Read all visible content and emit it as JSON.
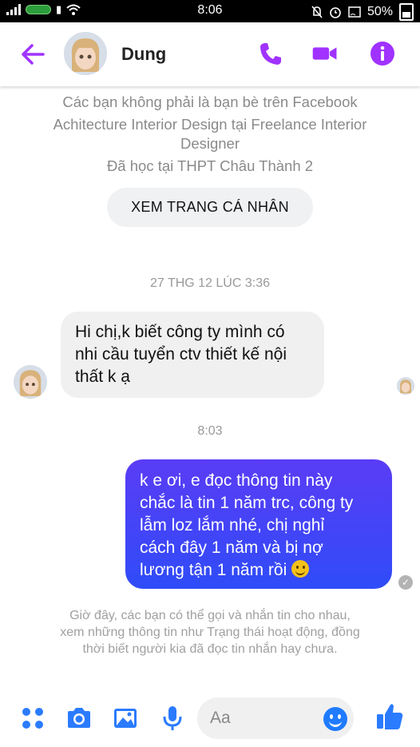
{
  "status_bar": {
    "time": "8:06",
    "battery": "50%"
  },
  "header": {
    "contact_name": "Dung"
  },
  "profile_info": {
    "line1": "Các bạn không phải là bạn bè trên Facebook",
    "line2": "Achitecture Interior Design tại Freelance Interior",
    "line3": "Designer",
    "line4": "Đã học tại THPT Châu Thành 2",
    "view_profile_button": "XEM TRANG CÁ NHÂN"
  },
  "messages": [
    {
      "timestamp": "27 THG 12 LÚC 3:36",
      "direction": "incoming",
      "lines": [
        "Hi chị,k biết công ty mình có",
        "nhi cầu tuyển ctv thiết kế nội",
        "thất k ạ"
      ]
    },
    {
      "timestamp": "8:03",
      "direction": "outgoing",
      "lines": [
        "k e ơi, e đọc thông tin này",
        "chắc là tin 1 năm trc, công ty",
        "lẫm loz lắm nhé, chị nghỉ",
        "cách đây 1 năm và bị nợ",
        "lương tận 1 năm rồi"
      ],
      "emoji": "slightly-smiling-face"
    }
  ],
  "notice": "Giờ đây, các bạn có thể gọi và nhắn tin cho nhau, xem những thông tin như Trạng thái hoạt động, đồng thời biết người kia đã đọc tin nhắn hay chưa.",
  "composer": {
    "placeholder": "Aa"
  },
  "colors": {
    "accent_purple": "#a033ff",
    "outgoing_bubble": "#2f4cf8",
    "composer_blue": "#2b7bff",
    "incoming_bubble": "#f1f0f0"
  }
}
